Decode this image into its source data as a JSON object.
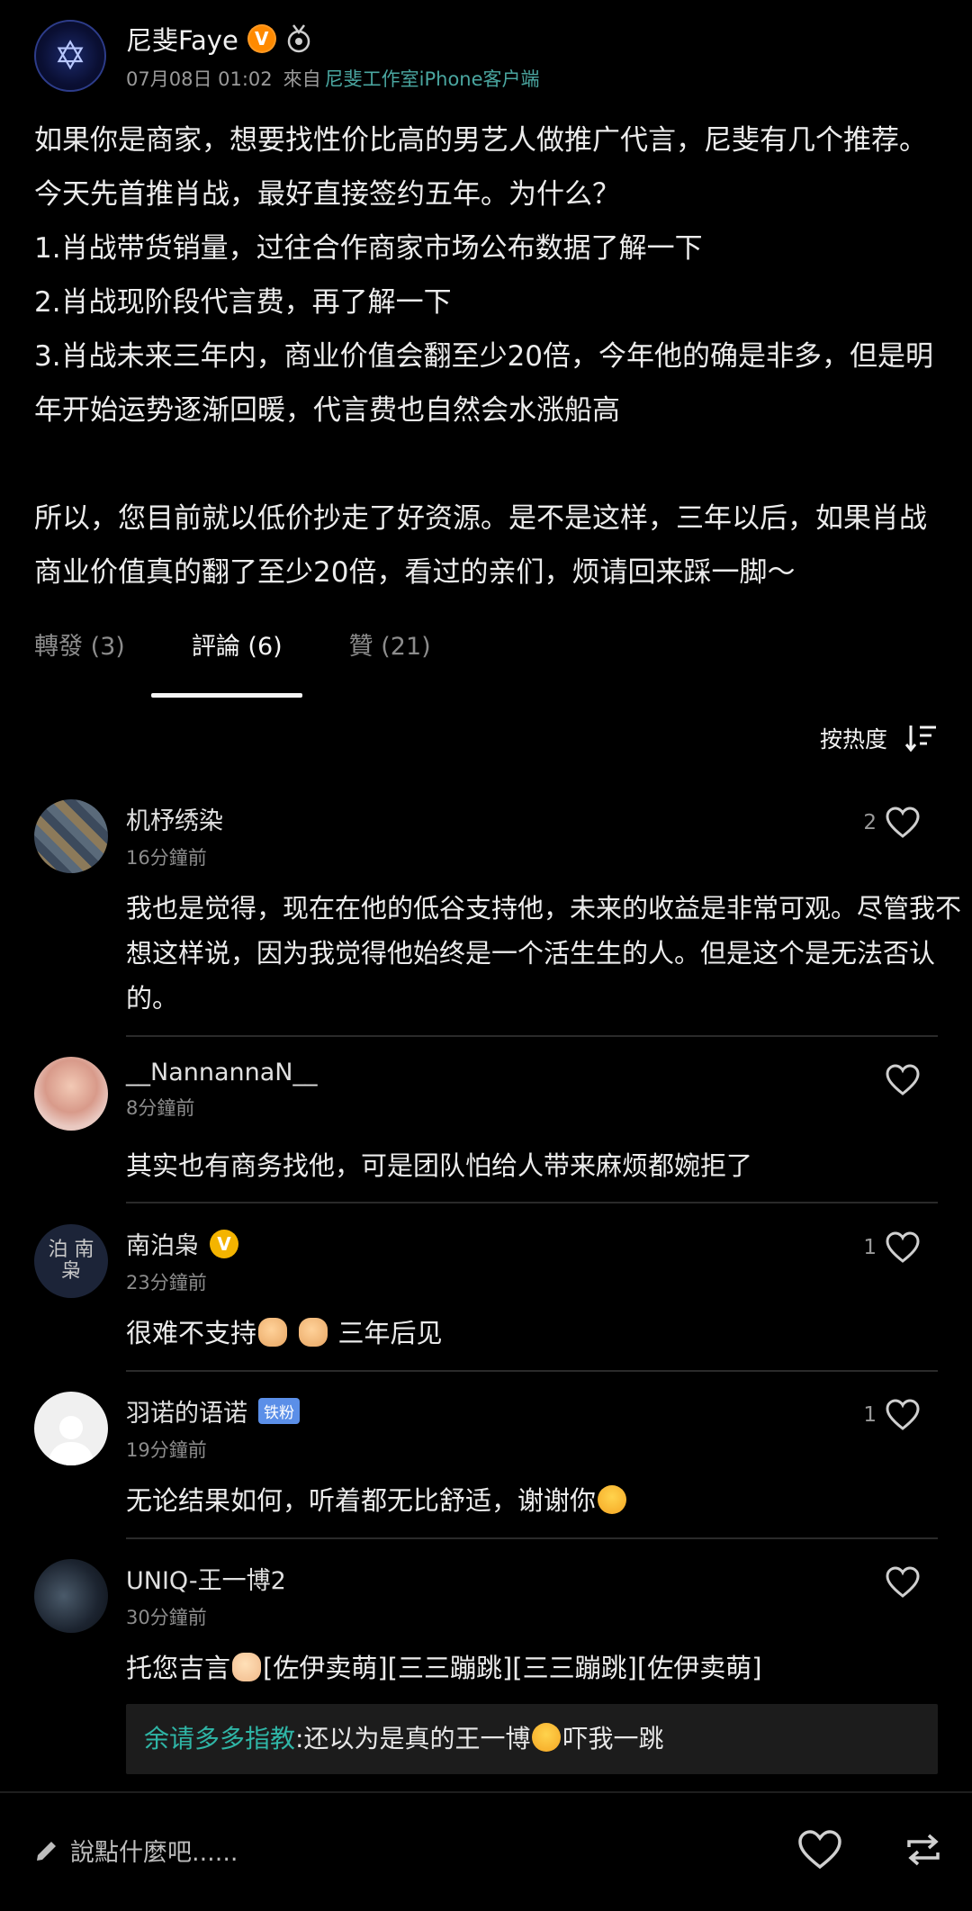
{
  "post": {
    "author": "尼斐Faye",
    "time": "07月08日 01:02",
    "from_prefix": "來自",
    "source": "尼斐工作室iPhone客户端",
    "body": "如果你是商家，想要找性价比高的男艺人做推广代言，尼斐有几个推荐。今天先首推肖战，最好直接签约五年。为什么？\n1.肖战带货销量，过往合作商家市场公布数据了解一下\n2.肖战现阶段代言费，再了解一下\n3.肖战未来三年内，商业价值会翻至少20倍，今年他的确是非多，但是明年开始运势逐渐回暖，代言费也自然会水涨船高\n\n所以，您目前就以低价抄走了好资源。是不是这样，三年以后，如果肖战商业价值真的翻了至少20倍，看过的亲们，烦请回来踩一脚～"
  },
  "tabs": {
    "repost": "轉發 (3)",
    "comments": "評論 (6)",
    "likes": "贊 (21)"
  },
  "sort": {
    "label": "按热度"
  },
  "comments": [
    {
      "name": "机杼绣染",
      "time": "16分鐘前",
      "likes": "2",
      "text": "我也是觉得，现在在他的低谷支持他，未来的收益是非常可观。尽管我不想这样说，因为我觉得他始终是一个活生生的人。但是这个是无法否认的。"
    },
    {
      "name": "__NannannaN__",
      "time": "8分鐘前",
      "likes": "",
      "text": "其实也有商务找他，可是团队怕给人带来麻烦都婉拒了"
    },
    {
      "name": "南泊枭",
      "time": "23分鐘前",
      "likes": "1",
      "text_a": "很难不支持",
      "text_b": "三年后见",
      "avatar_text": "泊 南 枭"
    },
    {
      "name": "羽诺的语诺",
      "badge": "铁粉",
      "time": "19分鐘前",
      "likes": "1",
      "text": "无论结果如何，听着都无比舒适，谢谢你"
    },
    {
      "name": "UNIQ-王一博2",
      "time": "30分鐘前",
      "likes": "",
      "text_a": "托您吉言",
      "text_b": "[佐伊卖萌][三三蹦跳][三三蹦跳][佐伊卖萌]",
      "reply_user": "余请多多指教",
      "reply_text_a": ":还以为是真的王一博",
      "reply_text_b": "吓我一跳"
    }
  ],
  "compose": {
    "placeholder": "說點什麼吧......"
  },
  "colors": {
    "accent_teal": "#2fb5a6",
    "badge_orange": "#ff8a00",
    "verified_yellow": "#f4b400"
  },
  "icons": [
    "medal-icon",
    "heart-icon",
    "sort-icon",
    "pencil-icon",
    "repost-icon"
  ]
}
